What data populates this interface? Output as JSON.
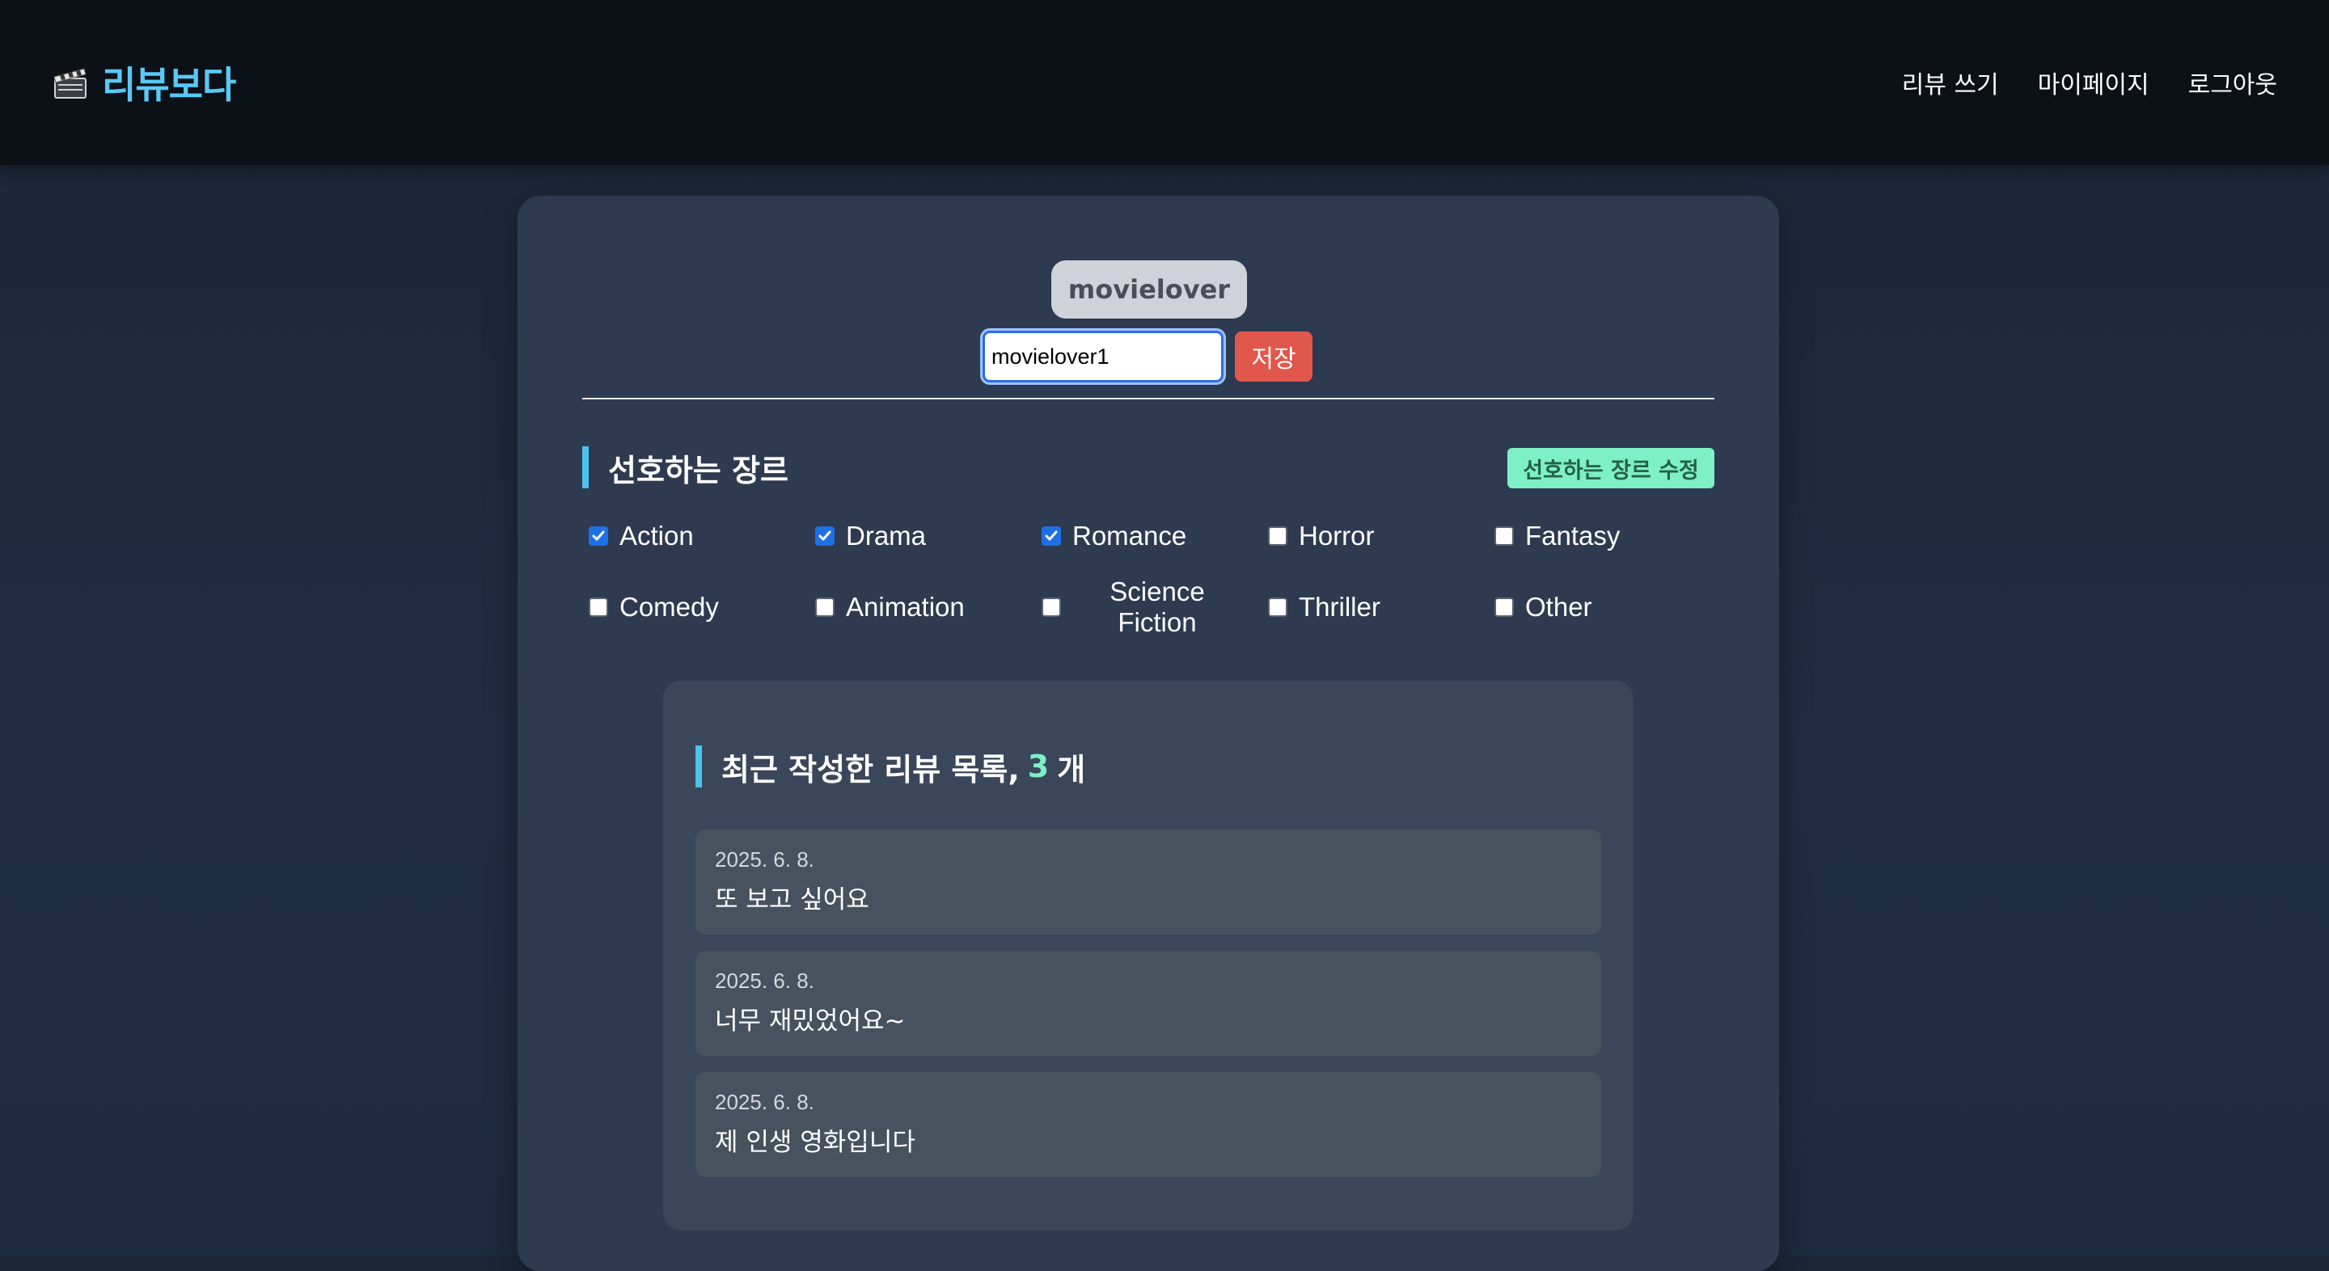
{
  "nav": {
    "brand": "리뷰보다",
    "brand_icon": "clapperboard-icon",
    "links": [
      "리뷰 쓰기",
      "마이페이지",
      "로그아웃"
    ]
  },
  "profile": {
    "username": "movielover",
    "name_input_value": "movielover1",
    "save_label": "저장"
  },
  "genres": {
    "title": "선호하는 장르",
    "edit_label": "선호하는 장르 수정",
    "items": [
      {
        "label": "Action",
        "checked": true
      },
      {
        "label": "Drama",
        "checked": true
      },
      {
        "label": "Romance",
        "checked": true
      },
      {
        "label": "Horror",
        "checked": false
      },
      {
        "label": "Fantasy",
        "checked": false
      },
      {
        "label": "Comedy",
        "checked": false
      },
      {
        "label": "Animation",
        "checked": false
      },
      {
        "label": "Science Fiction",
        "checked": false
      },
      {
        "label": "Thriller",
        "checked": false
      },
      {
        "label": "Other",
        "checked": false
      }
    ]
  },
  "reviews": {
    "title_prefix": "최근 작성한 리뷰 목록,",
    "count": "3",
    "title_suffix": "개",
    "items": [
      {
        "date": "2025. 6. 8.",
        "text": "또 보고 싶어요"
      },
      {
        "date": "2025. 6. 8.",
        "text": "너무 재밌었어요~"
      },
      {
        "date": "2025. 6. 8.",
        "text": "제 인생 영화입니다"
      }
    ]
  },
  "colors": {
    "accent": "#5ac8f5",
    "save_button": "#e2574c",
    "edit_button": "#7ef0c6",
    "checkbox_checked": "#1f6fe5"
  }
}
